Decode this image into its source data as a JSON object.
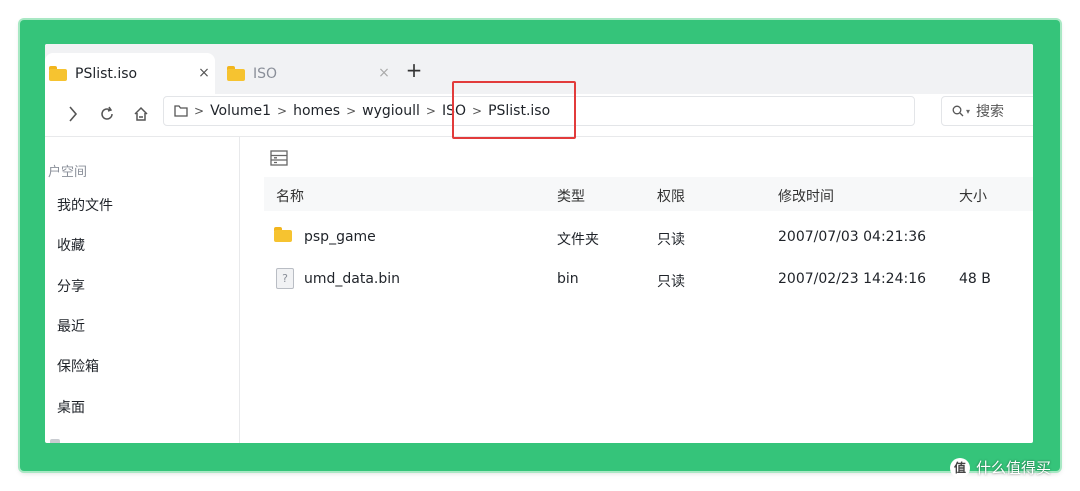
{
  "tabs": [
    {
      "label": "PSlist.iso",
      "icon": "folder-icon",
      "close": "×"
    },
    {
      "label": "ISO",
      "icon": "folder-icon",
      "close": "×"
    }
  ],
  "new_tab": "+",
  "toolbar": {
    "breadcrumb": [
      "Volume1",
      "homes",
      "wygioull",
      "ISO",
      "PSlist.iso"
    ],
    "search_placeholder": "搜索"
  },
  "sidebar": {
    "heading": "户空间",
    "items": [
      "我的文件",
      "收藏",
      "分享",
      "最近",
      "保险箱",
      "桌面"
    ]
  },
  "table": {
    "headers": [
      "名称",
      "类型",
      "权限",
      "修改时间",
      "大小"
    ],
    "rows": [
      {
        "name": "psp_game",
        "type": "文件夹",
        "perm": "只读",
        "mtime": "2007/07/03 04:21:36",
        "size": "",
        "icon": "folder-icon"
      },
      {
        "name": "umd_data.bin",
        "type": "bin",
        "perm": "只读",
        "mtime": "2007/02/23 14:24:16",
        "size": "48 B",
        "icon": "unknown-file-icon"
      }
    ]
  },
  "watermark": "什么值得买",
  "colors": {
    "frame": "#35c47a",
    "highlight": "#e23b3b",
    "folder": "#f6c330"
  }
}
